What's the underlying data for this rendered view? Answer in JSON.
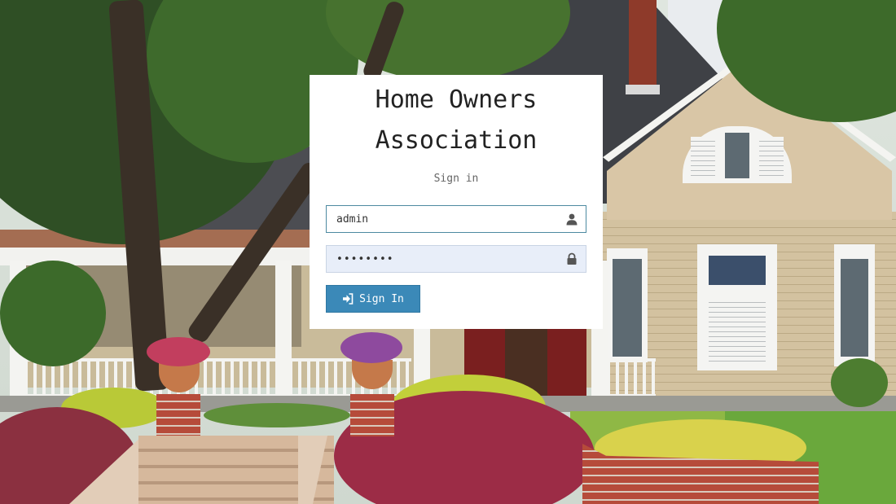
{
  "page": {
    "title_line1": "Home Owners",
    "title_line2": "Association",
    "subtitle": "Sign in"
  },
  "form": {
    "username": {
      "value": "admin",
      "icon": "user-icon"
    },
    "password": {
      "value": "••••••••",
      "icon": "lock-icon"
    },
    "submit": {
      "label": "Sign In",
      "icon": "sign-in-icon"
    }
  },
  "colors": {
    "button": "#3b89b8",
    "input_focus_border": "#4d8aa1",
    "password_bg": "#e8eef9"
  }
}
